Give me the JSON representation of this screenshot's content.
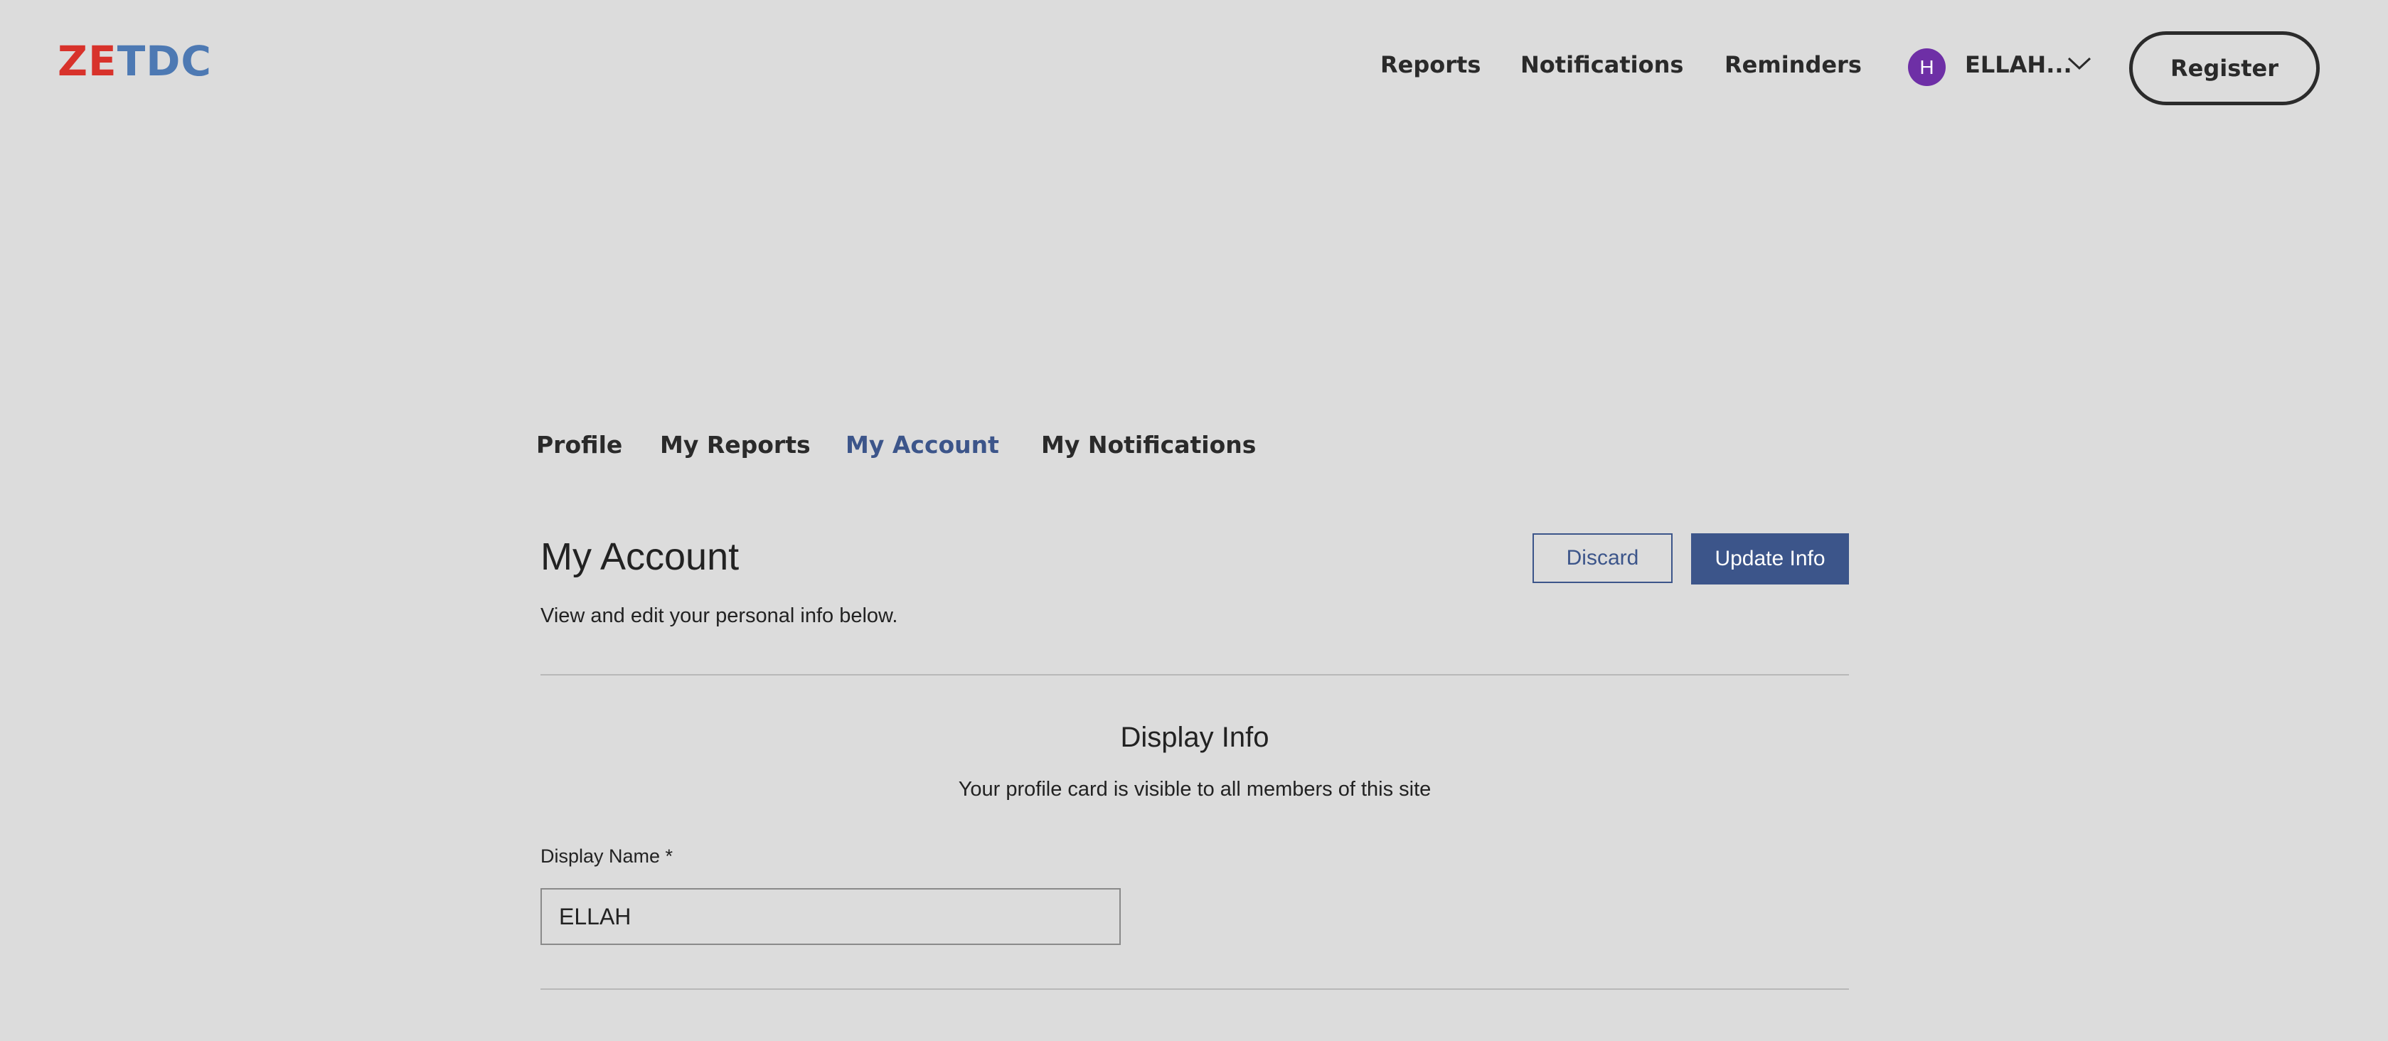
{
  "header": {
    "logo_part1": "ZE",
    "logo_part2": "TDC",
    "nav": {
      "reports": "Reports",
      "notifications": "Notifications",
      "reminders": "Reminders"
    },
    "user": {
      "avatar_initial": "H",
      "name": "ELLAH...",
      "menu_icon": "chevron-down-icon"
    },
    "register_label": "Register"
  },
  "tabs": {
    "profile": "Profile",
    "my_reports": "My Reports",
    "my_account": "My Account",
    "my_notifications": "My Notifications",
    "active": "My Account"
  },
  "account": {
    "title": "My Account",
    "subtitle": "View and edit your personal info below.",
    "discard_label": "Discard",
    "update_label": "Update Info"
  },
  "display_info": {
    "title": "Display Info",
    "subtitle": "Your profile card is visible to all members of this site",
    "display_name_label": "Display Name *",
    "display_name_value": "ELLAH"
  },
  "colors": {
    "background": "#dcdcdc",
    "accent": "#3c558a",
    "logo_red": "#d8322b",
    "logo_blue": "#4d79b3",
    "avatar": "#6e2fa6"
  }
}
